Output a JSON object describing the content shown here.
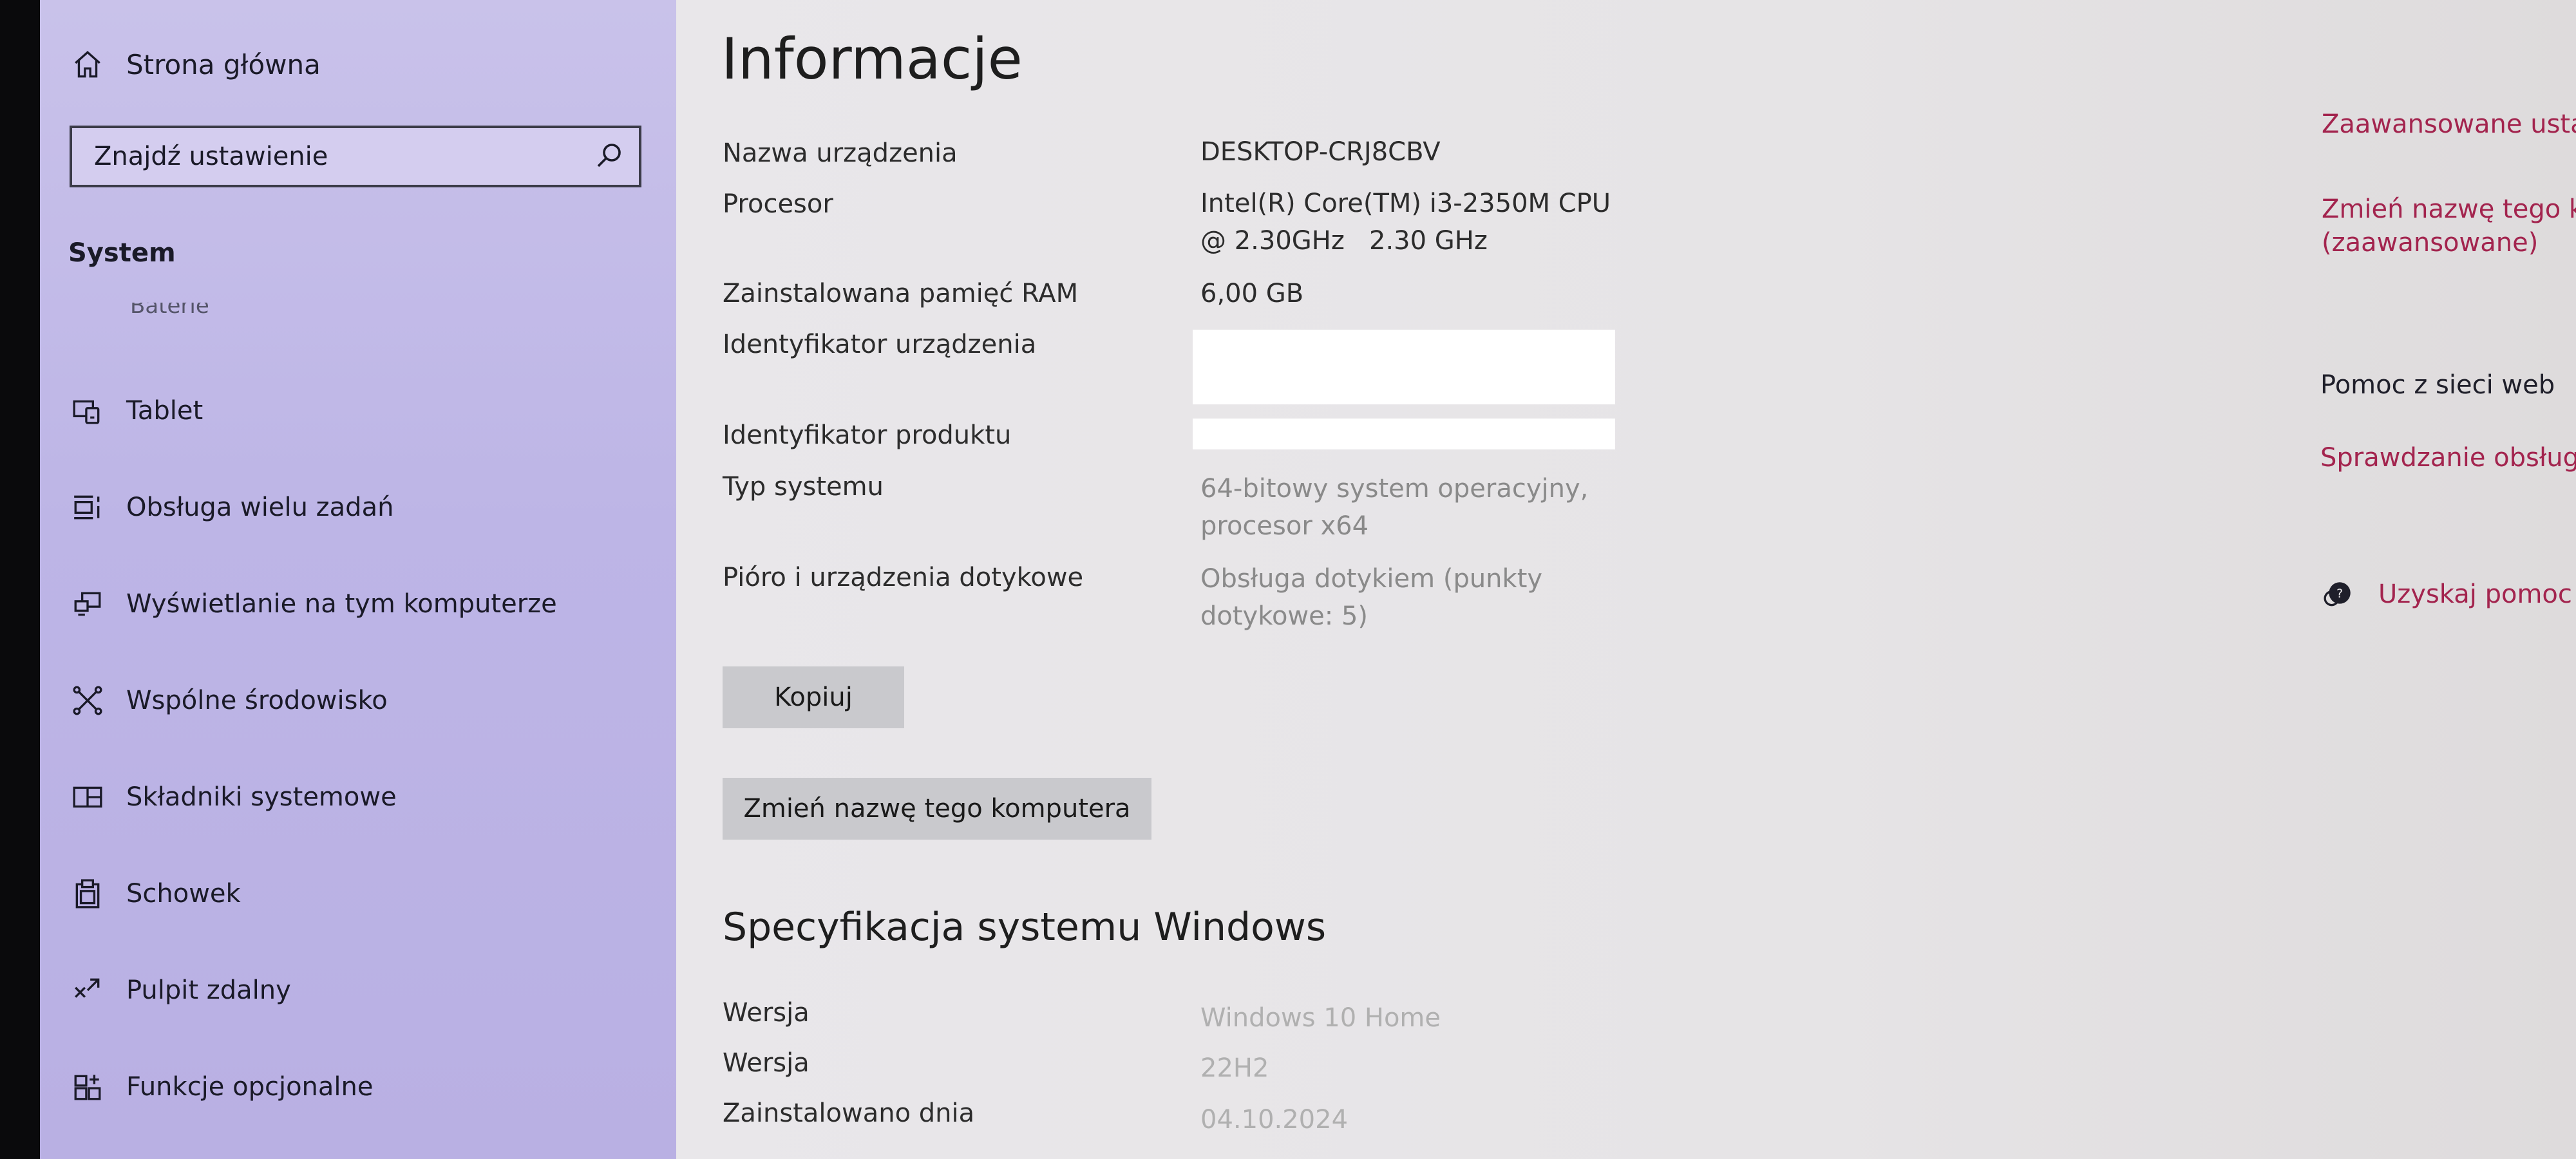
{
  "sidebar": {
    "home_label": "Strona główna",
    "search_placeholder": "Znajdź ustawienie",
    "section_title": "System",
    "cut_item_label": "Baterie",
    "items": [
      {
        "label": "Tablet",
        "icon": "tablet-icon"
      },
      {
        "label": "Obsługa wielu zadań",
        "icon": "multitasking-icon"
      },
      {
        "label": "Wyświetlanie na tym komputerze",
        "icon": "projecting-icon"
      },
      {
        "label": "Wspólne środowisko",
        "icon": "shared-experiences-icon"
      },
      {
        "label": "Składniki systemowe",
        "icon": "system-components-icon"
      },
      {
        "label": "Schowek",
        "icon": "clipboard-icon"
      },
      {
        "label": "Pulpit zdalny",
        "icon": "remote-desktop-icon"
      },
      {
        "label": "Funkcje opcjonalne",
        "icon": "optional-features-icon"
      }
    ]
  },
  "main": {
    "title": "Informacje",
    "device_specs": [
      {
        "label": "Nazwa urządzenia",
        "value_lines": [
          "DESKTOP-CRJ8CBV"
        ]
      },
      {
        "label": "Procesor",
        "value_lines": [
          "Intel(R) Core(TM) i3-2350M CPU",
          "@ 2.30GHz   2.30 GHz"
        ]
      },
      {
        "label": "Zainstalowana pamięć RAM",
        "value_lines": [
          "6,00 GB"
        ]
      },
      {
        "label": "Identyfikator urządzenia",
        "value_lines": []
      },
      {
        "label": "Identyfikator produktu",
        "value_lines": []
      },
      {
        "label": "Typ systemu",
        "value_lines": [
          "64-bitowy system operacyjny,",
          "procesor x64"
        ]
      },
      {
        "label": "Pióro i urządzenia dotykowe",
        "value_lines": [
          "Obsługa dotykiem (punkty",
          "dotykowe: 5)"
        ]
      }
    ],
    "copy_button": "Kopiuj",
    "rename_button": "Zmień nazwę tego komputera",
    "windows_section_title": "Specyfikacja systemu Windows",
    "windows_specs": [
      {
        "label": "Wersja",
        "value": "Windows 10 Home"
      },
      {
        "label": "Wersja",
        "value": "22H2"
      },
      {
        "label": "Zainstalowano dnia",
        "value": "04.10.2024"
      }
    ]
  },
  "related": {
    "advanced_settings": "Zaawansowane ustawie",
    "rename_advanced_line1": "Zmień nazwę tego kom",
    "rename_advanced_line2": "(zaawansowane)",
    "help_heading": "Pomoc z sieci web",
    "check_support": "Sprawdzanie obsługi w",
    "get_help": "Uzyskaj pomoc"
  },
  "colors": {
    "sidebar_bg": "#bdb5e6",
    "main_bg": "#e6e4e6",
    "link": "#a3244e",
    "button_bg": "#c9c9cd"
  }
}
